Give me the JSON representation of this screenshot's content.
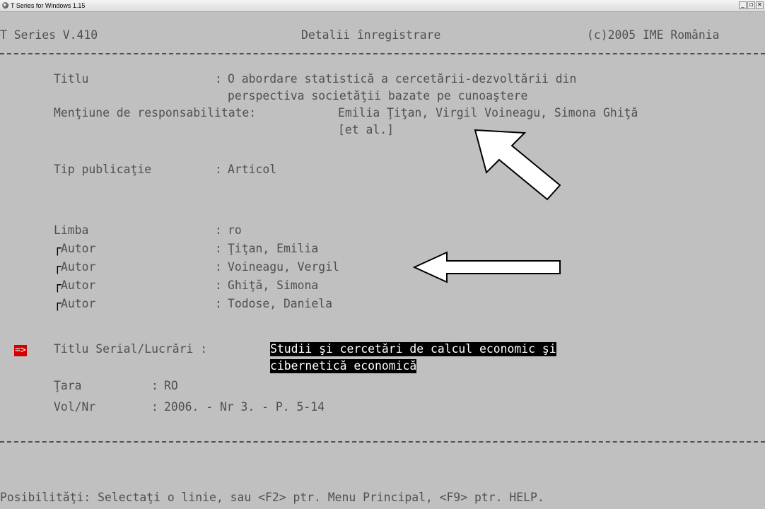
{
  "window": {
    "title": "T Series for Windows 1.15",
    "minimize": "_",
    "maximize": "▫",
    "close": "×"
  },
  "header": {
    "app_version": "T Series V.410",
    "screen_title": "Detalii înregistrare",
    "copyright": "(c)2005 IME România"
  },
  "record": {
    "titlu_label": "Titlu",
    "titlu_sep": ":",
    "titlu_line1": "O abordare statistică a cercetării-dezvoltării din",
    "titlu_line2": "perspectiva societăţii bazate pe cunoaştere",
    "mentiune_label": "Menţiune de responsabilitate:",
    "mentiune_value": "Emilia Ţiţan, Virgil Voineagu, Simona Ghiţă",
    "mentiune_value2": "[et al.]",
    "tip_label": "Tip publicaţie",
    "tip_sep": ":",
    "tip_value": "Articol",
    "limba_label": "Limba",
    "limba_sep": ":",
    "limba_value": "ro",
    "autor_marker": "┌",
    "autori": [
      {
        "label": "Autor",
        "sep": ":",
        "value": "Ţiţan, Emilia"
      },
      {
        "label": "Autor",
        "sep": ":",
        "value": "Voineagu, Vergil"
      },
      {
        "label": "Autor",
        "sep": ":",
        "value": "Ghiţă, Simona"
      },
      {
        "label": "Autor",
        "sep": ":",
        "value": "Todose, Daniela"
      }
    ],
    "cursor_marker": "=>",
    "serial_label": "Titlu Serial/Lucrări :",
    "serial_line1": "Studii şi cercetări de calcul economic şi",
    "serial_line2": "cibernetică economică",
    "tara_label": "Ţara",
    "tara_sep": ":",
    "tara_value": "RO",
    "volnr_label": "Vol/Nr",
    "volnr_sep": ":",
    "volnr_value": "2006. - Nr 3. - P. 5-14"
  },
  "footer": {
    "prompt": "Posibilităţi: Selectaţi o linie, sau <F2> ptr. Menu Principal, <F9> ptr. HELP."
  },
  "colors": {
    "screen_background": "#c0c0c0",
    "text": "#505050",
    "highlight_background": "#000000",
    "highlight_text": "#ffffff",
    "cursor_marker": "#d40000"
  }
}
